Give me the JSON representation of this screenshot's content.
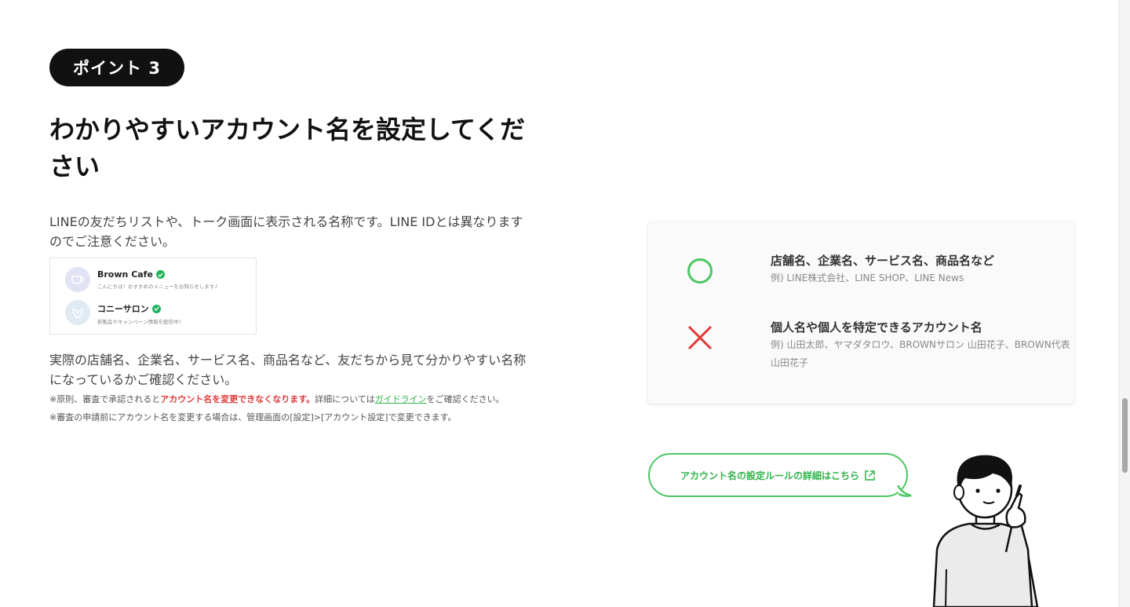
{
  "point": {
    "badge": "ポイント 3"
  },
  "title": "わかりやすいアカウント名を設定してください",
  "lead": "LINEの友だちリストや、トーク画面に表示される名称です。LINE IDとは異なりますのでご注意ください。",
  "sample_accounts": [
    {
      "name": "Brown Cafe",
      "desc": "こんにちは！おすすめのメニューをお知らせします♪"
    },
    {
      "name": "コニーサロン",
      "desc": "新製品やキャンペーン情報を配信中！"
    }
  ],
  "body2": "実際の店舗名、企業名、サービス名、商品名など、友だちから見て分かりやすい名称になっているかご確認ください。",
  "notes": {
    "n1_prefix": "※原則、審査で承認されると",
    "n1_red": "アカウント名を変更できなくなります。",
    "n1_mid": "詳細については",
    "n1_link": "ガイドライン",
    "n1_suffix": "をご確認ください。",
    "n2": "※審査の申請前にアカウント名を変更する場合は、管理画面の[設定]>[アカウント設定]で変更できます。"
  },
  "rules": {
    "ok": {
      "title": "店舗名、企業名、サービス名、商品名など",
      "example": "例) LINE株式会社、LINE SHOP、LINE News"
    },
    "ng": {
      "title": "個人名や個人を特定できるアカウント名",
      "example": "例) 山田太郎、ヤマダタロウ、BROWNサロン 山田花子、BROWN代表 山田花子"
    }
  },
  "cta": {
    "label": "アカウント名の設定ルールの詳細はこちら"
  },
  "colors": {
    "green": "#4cc764",
    "red": "#e23a3a",
    "badge_bg": "#111111"
  }
}
